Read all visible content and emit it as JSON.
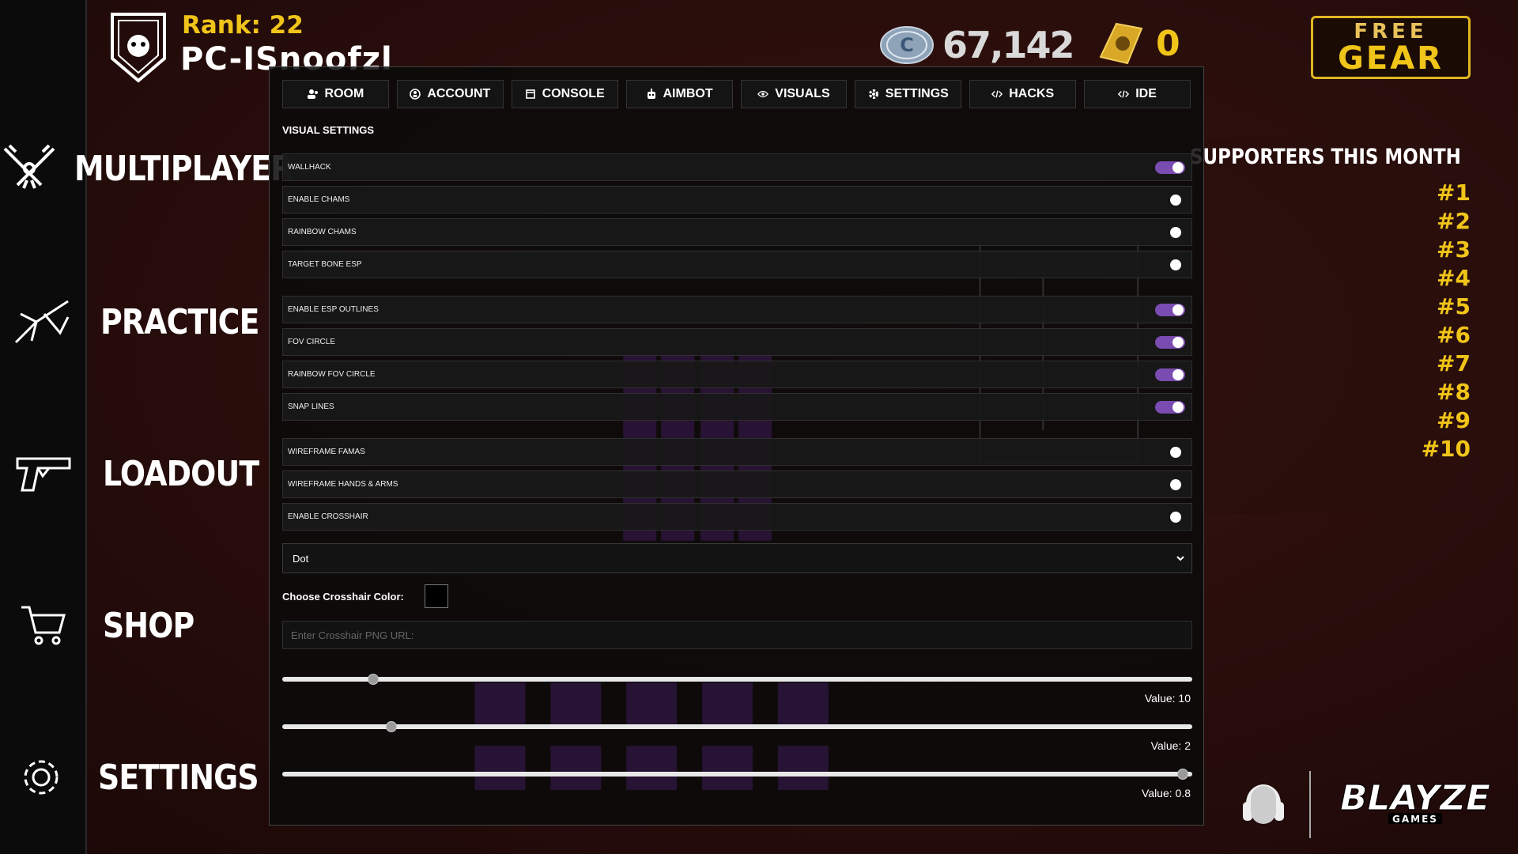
{
  "header": {
    "rank_text": "Rank: 22",
    "player_name": "PC-ISnoofzl",
    "coins": "67,142",
    "gold": "0",
    "free_gear_line1": "FREE",
    "free_gear_line2": "GEAR"
  },
  "nav": {
    "items": [
      {
        "label": "MULTIPLAYER",
        "icon": "crossed-guns-icon"
      },
      {
        "label": "PRACTICE",
        "icon": "target-icon"
      },
      {
        "label": "LOADOUT",
        "icon": "pistol-icon"
      },
      {
        "label": "SHOP",
        "icon": "cart-icon"
      },
      {
        "label": "SETTINGS",
        "icon": "gear-icon"
      }
    ]
  },
  "supporters": {
    "title": "SUPPORTERS THIS MONTH",
    "ranks": [
      "#1",
      "#2",
      "#3",
      "#4",
      "#5",
      "#6",
      "#7",
      "#8",
      "#9",
      "#10"
    ]
  },
  "panel": {
    "tabs": [
      {
        "label": "ROOM",
        "icon": "users-icon"
      },
      {
        "label": "ACCOUNT",
        "icon": "account-icon"
      },
      {
        "label": "CONSOLE",
        "icon": "console-icon"
      },
      {
        "label": "AIMBOT",
        "icon": "robot-icon"
      },
      {
        "label": "VISUALS",
        "icon": "eye-icon"
      },
      {
        "label": "SETTINGS",
        "icon": "gear-icon"
      },
      {
        "label": "HACKS",
        "icon": "code-icon"
      },
      {
        "label": "IDE",
        "icon": "code-icon"
      }
    ],
    "section_title": "VISUAL SETTINGS",
    "settings": [
      {
        "label": "WALLHACK",
        "on": true
      },
      {
        "label": "ENABLE CHAMS",
        "on": false
      },
      {
        "label": "RAINBOW CHAMS",
        "on": false
      },
      {
        "label": "TARGET BONE ESP",
        "on": false
      },
      {
        "label": "ENABLE ESP OUTLINES",
        "on": true
      },
      {
        "label": "FOV CIRCLE",
        "on": true
      },
      {
        "label": "RAINBOW FOV CIRCLE",
        "on": true
      },
      {
        "label": "SNAP LINES",
        "on": true
      },
      {
        "label": "WIREFRAME FAMAS",
        "on": false
      },
      {
        "label": "WIREFRAME HANDS & ARMS",
        "on": false
      },
      {
        "label": "ENABLE CROSSHAIR",
        "on": false
      }
    ],
    "crosshair_select": "Dot",
    "color_label": "Choose Crosshair Color:",
    "crosshair_color": "#000000",
    "png_url_placeholder": "Enter Crosshair PNG URL:",
    "sliders": [
      {
        "value_text": "Value: 10",
        "fraction": 0.1
      },
      {
        "value_text": "Value: 2",
        "fraction": 0.12
      },
      {
        "value_text": "Value: 0.8",
        "fraction": 0.99
      }
    ]
  },
  "colors": {
    "accent_gold": "#f0c419",
    "toggle_on": "#7a4bb0"
  }
}
